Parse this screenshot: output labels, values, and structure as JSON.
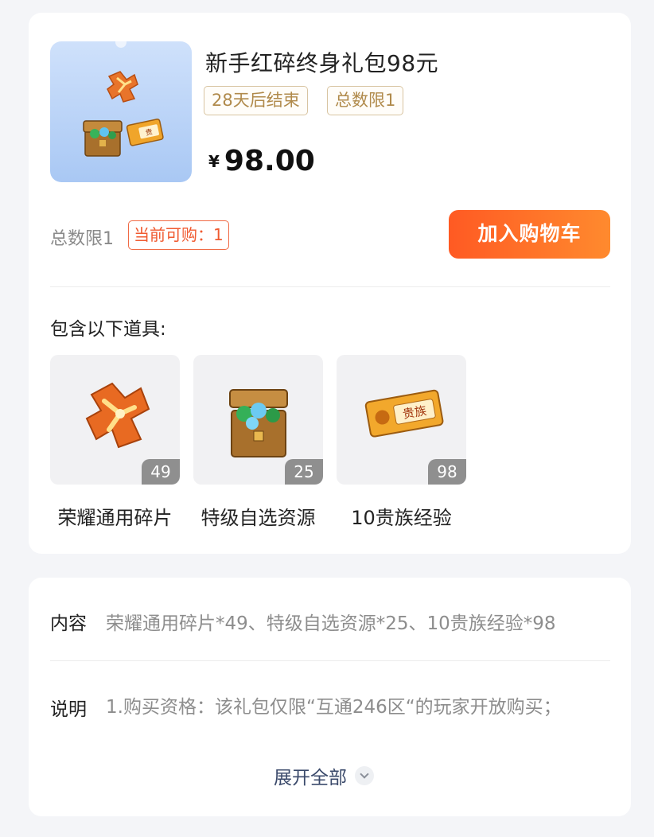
{
  "product": {
    "title": "新手红碎终身礼包98元",
    "tags": [
      "28天后结束",
      "总数限1"
    ],
    "currency": "¥",
    "price": "98.00",
    "limit_text": "总数限1",
    "can_buy_text": "当前可购：1",
    "cart_button": "加入购物车"
  },
  "contents": {
    "label": "包含以下道具:",
    "items": [
      {
        "name": "荣耀通用碎片",
        "count": "49",
        "icon": "honor-fragment-icon"
      },
      {
        "name": "特级自选资源",
        "count": "25",
        "icon": "resource-chest-icon"
      },
      {
        "name": "10贵族经验",
        "count": "98",
        "icon": "noble-card-icon"
      }
    ]
  },
  "details": {
    "content_label": "内容",
    "content_value": "荣耀通用碎片*49、特级自选资源*25、10贵族经验*98",
    "desc_label": "说明",
    "desc_value": "1.购买资格：该礼包仅限“互通246区“的玩家开放购买；",
    "expand_label": "展开全部"
  },
  "colors": {
    "accent": "#ff6a28",
    "tag_border": "#d8c4a1",
    "tag_text": "#b08a4b",
    "can_buy": "#f05a30"
  }
}
